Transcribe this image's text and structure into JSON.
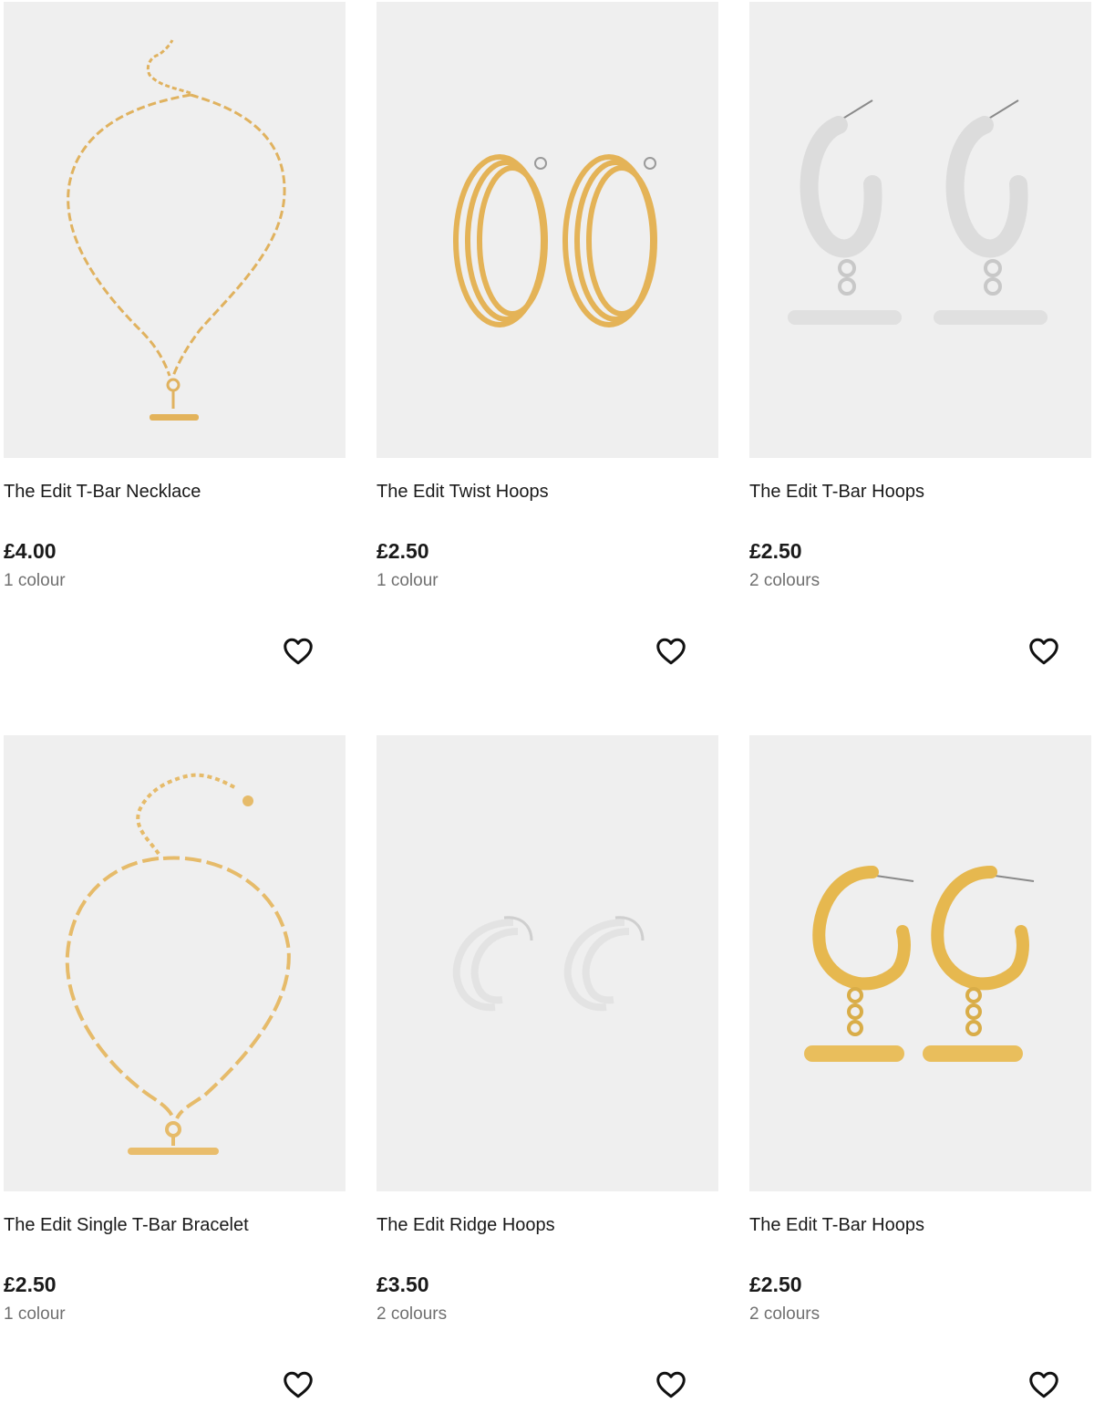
{
  "accent_colors": {
    "gold": "#e3b35b",
    "silver": "#e2e2e2",
    "image_bg": "#efefef",
    "text": "#1a1a1a",
    "muted": "#707070"
  },
  "products": [
    {
      "name": "The Edit T-Bar Necklace",
      "price": "£4.00",
      "colours": "1 colour",
      "image_icon": "gold-t-bar-necklace-image",
      "favourite_icon": "heart-outline-icon"
    },
    {
      "name": "The Edit Twist Hoops",
      "price": "£2.50",
      "colours": "1 colour",
      "image_icon": "gold-twist-hoops-image",
      "favourite_icon": "heart-outline-icon"
    },
    {
      "name": "The Edit T-Bar Hoops",
      "price": "£2.50",
      "colours": "2 colours",
      "image_icon": "silver-t-bar-hoops-image",
      "favourite_icon": "heart-outline-icon"
    },
    {
      "name": "The Edit Single T-Bar Bracelet",
      "price": "£2.50",
      "colours": "1 colour",
      "image_icon": "gold-t-bar-bracelet-image",
      "favourite_icon": "heart-outline-icon"
    },
    {
      "name": "The Edit Ridge Hoops",
      "price": "£3.50",
      "colours": "2 colours",
      "image_icon": "silver-ridge-hoops-image",
      "favourite_icon": "heart-outline-icon"
    },
    {
      "name": "The Edit T-Bar Hoops",
      "price": "£2.50",
      "colours": "2 colours",
      "image_icon": "gold-t-bar-hoops-image",
      "favourite_icon": "heart-outline-icon"
    }
  ]
}
